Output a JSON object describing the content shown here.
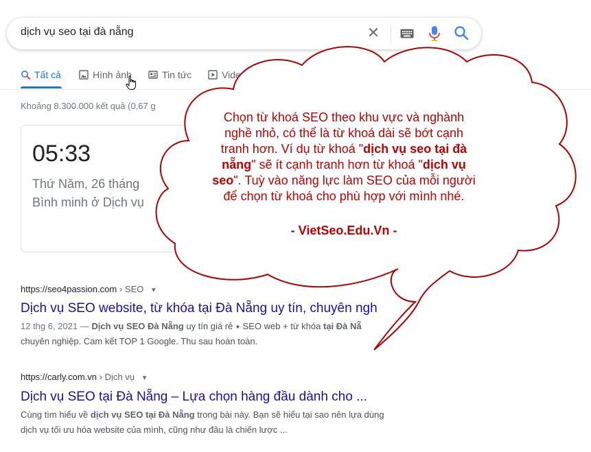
{
  "search": {
    "query": "dịch vụ seo tại đà nẵng",
    "clear_icon": "close-icon",
    "keyboard_icon": "keyboard-icon",
    "mic_icon": "microphone-icon",
    "search_icon": "search-icon"
  },
  "tabs": [
    {
      "label": "Tất cả",
      "icon": "search-icon",
      "active": true
    },
    {
      "label": "Hình ảnh",
      "icon": "image-icon"
    },
    {
      "label": "Tin tức",
      "icon": "news-icon"
    },
    {
      "label": "Video",
      "icon": "play-icon"
    }
  ],
  "stats": "Khoảng 8.300.000 kết quả (0,67 g",
  "clock": {
    "time": "05:33",
    "date": "Thứ Năm, 26 tháng",
    "sunrise": "Bình minh ở Dịch vụ"
  },
  "results": [
    {
      "domain": "https://seo4passion.com",
      "path": "› SEO",
      "title": "Dịch vụ SEO website, từ khóa tại Đà Nẵng uy tín, chuyên ngh",
      "snippet_date": "12 thg 6, 2021 — ",
      "snippet_b1": "Dịch vụ SEO Đà Nẵng",
      "snippet_t1": " uy tín giá rẻ ⭑ SEO web + từ khóa ",
      "snippet_b2": "tại Đà Nẵ",
      "snippet_line2": "chuyên nghiệp. Cam kết TOP 1 Google. Thu sau hoàn toàn."
    },
    {
      "domain": "https://carly.com.vn",
      "path": "› Dịch vụ",
      "title": "Dịch vụ SEO tại Đà Nẵng – Lựa chọn hàng đầu dành cho ...",
      "snippet_t0": "Cùng tìm hiểu về ",
      "snippet_b1": "dịch vụ SEO tại Đà Nẵng",
      "snippet_t1": " trong bài này. Bạn sẽ hiểu tại sao nên lựa dùng",
      "snippet_line2": "dịch vụ tối ưu hóa website của mình, cũng như đâu là chiến lược ..."
    }
  ],
  "callout": {
    "t1": "Chọn từ khoá SEO theo khu vực và nghành",
    "t2": "nghề nhỏ, có thể là từ khoá dài sẽ bớt cạnh",
    "t3": "tranh hơn. Ví dụ từ khoá \"",
    "b1": "dịch vụ seo tại đà",
    "b2": "nẵng",
    "t4": "\" sẽ ít cạnh tranh hơn từ khoá \"",
    "b3": "dịch vụ",
    "b4": "seo",
    "t5": "\". Tuỳ vào năng lực làm SEO của mỗi người",
    "t6": "để chọn từ khoá cho phù hợp với mình nhé.",
    "signature": "- VietSeo.Edu.Vn -",
    "color": "#c00000"
  }
}
